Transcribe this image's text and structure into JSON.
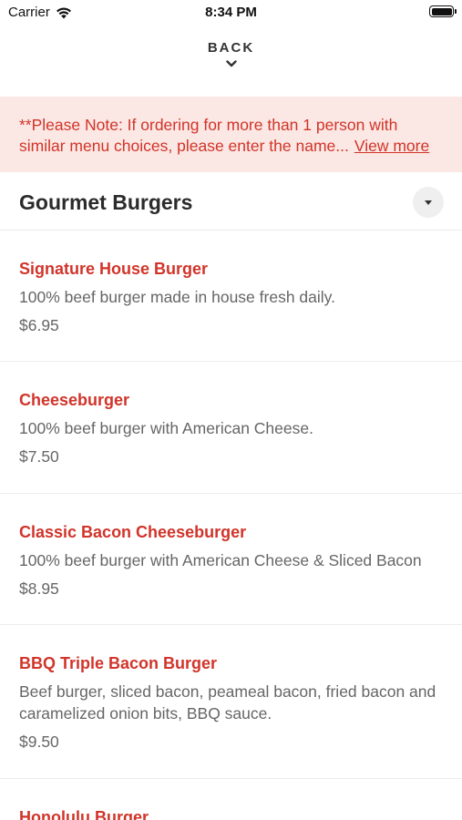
{
  "status_bar": {
    "carrier": "Carrier",
    "time": "8:34 PM",
    "wifi_icon": "wifi-icon",
    "battery_icon": "battery-icon"
  },
  "nav": {
    "back_label": "BACK",
    "back_icon": "chevron-down-icon"
  },
  "notice": {
    "text": "**Please Note: If ordering for more than 1 person with similar menu choices, please enter the name...",
    "link": "View more"
  },
  "category": {
    "title": "Gourmet Burgers",
    "toggle_icon": "caret-down-icon"
  },
  "items": [
    {
      "name": "Signature House Burger",
      "description": "100% beef burger made in house fresh daily.",
      "price": "$6.95"
    },
    {
      "name": "Cheeseburger",
      "description": "100% beef burger with American Cheese.",
      "price": "$7.50"
    },
    {
      "name": "Classic Bacon Cheeseburger",
      "description": "100% beef burger with American Cheese & Sliced Bacon",
      "price": "$8.95"
    },
    {
      "name": "BBQ Triple Bacon Burger",
      "description": "Beef burger, sliced bacon, peameal bacon, fried bacon and caramelized onion bits, BBQ sauce.",
      "price": "$9.50"
    },
    {
      "name": "Honolulu Burger",
      "description": "",
      "price": ""
    }
  ],
  "colors": {
    "accent": "#d1342a",
    "notice_bg": "#fbe7e3"
  }
}
